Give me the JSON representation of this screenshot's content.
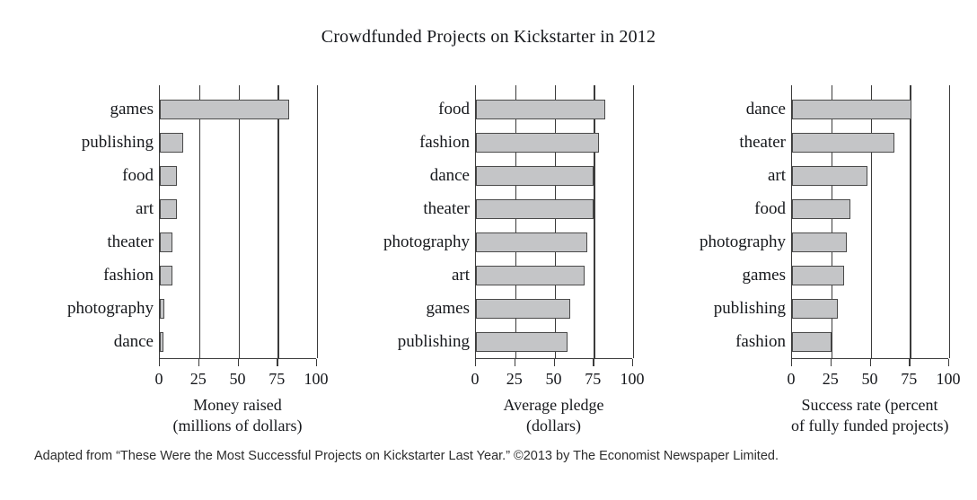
{
  "title": "Crowdfunded Projects on Kickstarter in 2012",
  "caption": "Adapted from “These Were the Most Successful Projects on Kickstarter Last Year.” ©2013 by The Economist Newspaper Limited.",
  "colors": {
    "bar_fill": "#c4c5c7",
    "bar_stroke": "#4a4a4a",
    "axis": "#3b3b3b",
    "text": "#16181c",
    "caption_text": "#2d2d2d",
    "background": "#ffffff"
  },
  "axis": {
    "ticks": [
      "0",
      "25",
      "50",
      "75",
      "100"
    ],
    "min": 0,
    "max": 100
  },
  "chart_data": [
    {
      "type": "bar",
      "orientation": "horizontal",
      "title": "Crowdfunded Projects on Kickstarter in 2012",
      "panel_index": 1,
      "xlabel_lines": [
        "Money raised",
        "(millions of dollars)"
      ],
      "ylabel": "",
      "xlim": [
        0,
        100
      ],
      "xticks": [
        0,
        25,
        50,
        75,
        100
      ],
      "grid": true,
      "legend": "none",
      "categories": [
        "games",
        "publishing",
        "food",
        "art",
        "theater",
        "fashion",
        "photography",
        "dance"
      ],
      "values": [
        82,
        15,
        11,
        11,
        8,
        8,
        3,
        2
      ]
    },
    {
      "type": "bar",
      "orientation": "horizontal",
      "panel_index": 2,
      "xlabel_lines": [
        "Average pledge",
        "(dollars)"
      ],
      "ylabel": "",
      "xlim": [
        0,
        100
      ],
      "xticks": [
        0,
        25,
        50,
        75,
        100
      ],
      "grid": true,
      "legend": "none",
      "categories": [
        "food",
        "fashion",
        "dance",
        "theater",
        "photography",
        "art",
        "games",
        "publishing"
      ],
      "values": [
        82,
        78,
        75,
        75,
        71,
        69,
        60,
        58
      ]
    },
    {
      "type": "bar",
      "orientation": "horizontal",
      "panel_index": 3,
      "xlabel_lines": [
        "Success rate (percent",
        "of fully funded projects)"
      ],
      "ylabel": "",
      "xlim": [
        0,
        100
      ],
      "xticks": [
        0,
        25,
        50,
        75,
        100
      ],
      "grid": true,
      "legend": "none",
      "categories": [
        "dance",
        "theater",
        "art",
        "food",
        "photography",
        "games",
        "publishing",
        "fashion"
      ],
      "values": [
        76,
        65,
        48,
        37,
        35,
        33,
        29,
        25
      ]
    }
  ]
}
